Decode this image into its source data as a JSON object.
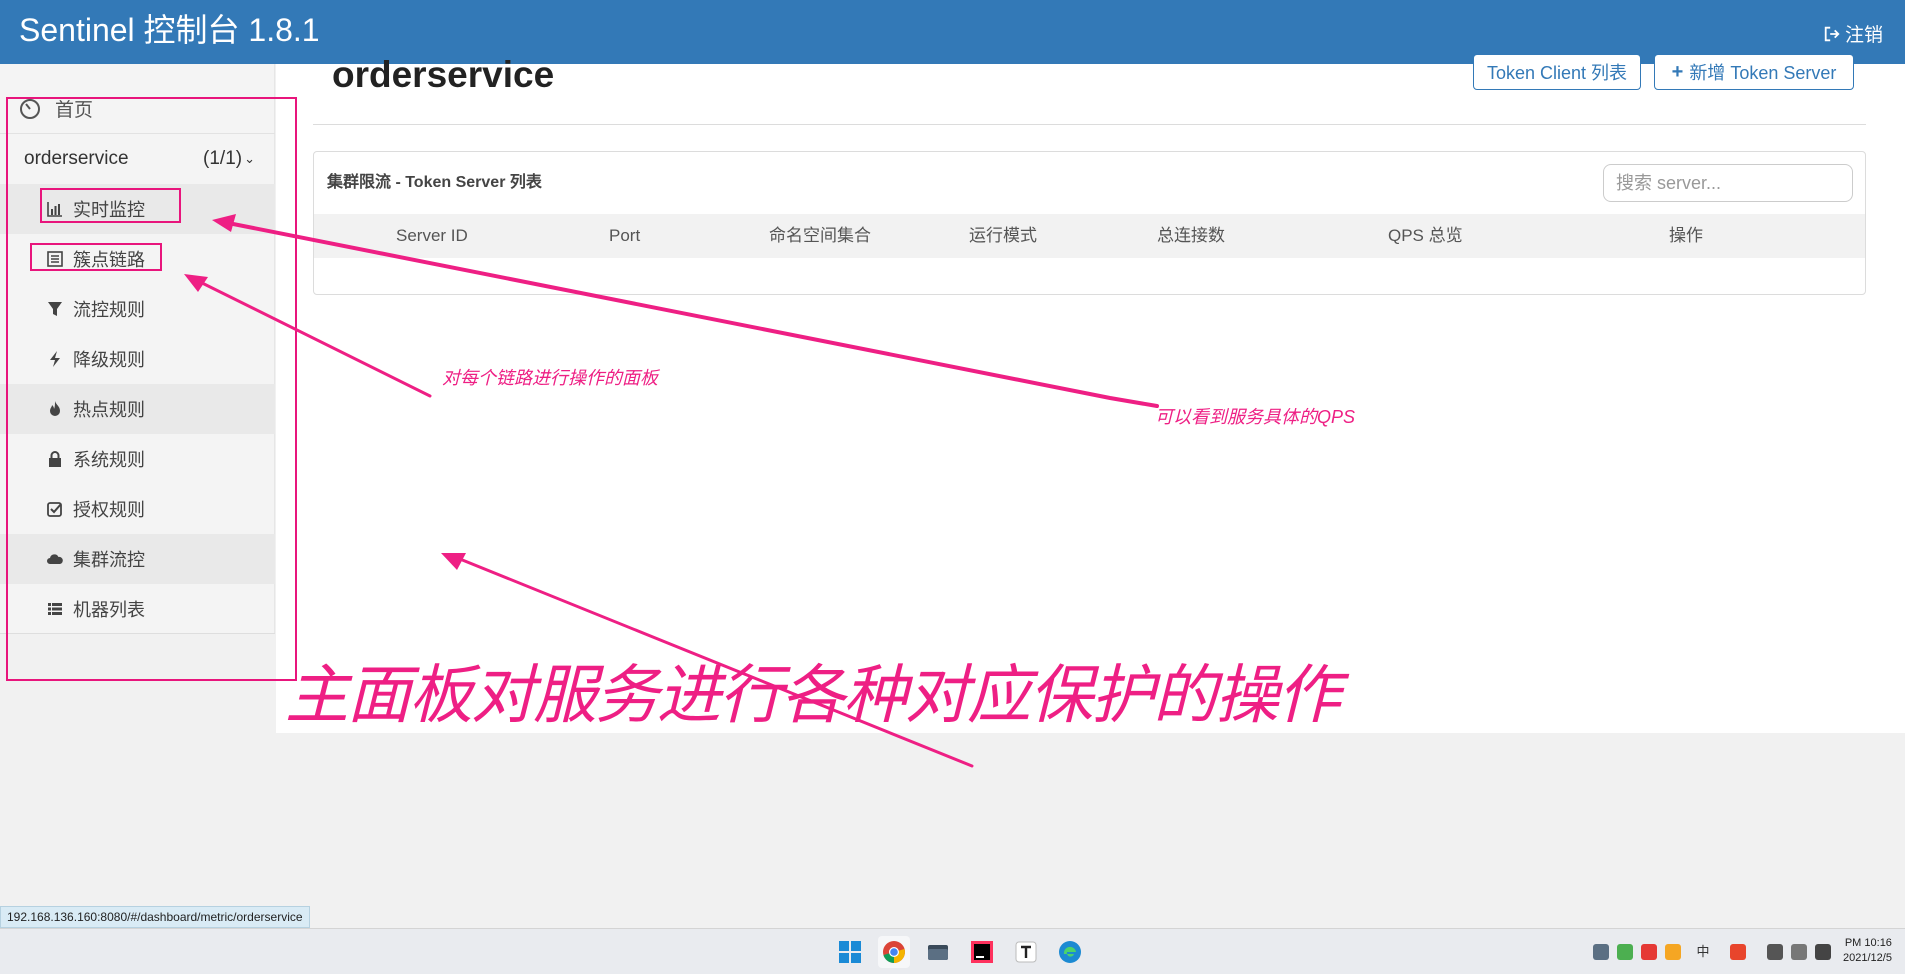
{
  "app": {
    "title": "Sentinel 控制台 1.8.1",
    "logout_label": "注销"
  },
  "sidebar": {
    "home_label": "首页",
    "app_name": "orderservice",
    "app_count": "(1/1)",
    "items": [
      {
        "label": "实时监控",
        "icon": "bar-chart-icon"
      },
      {
        "label": "簇点链路",
        "icon": "list-alt-icon"
      },
      {
        "label": "流控规则",
        "icon": "filter-icon"
      },
      {
        "label": "降级规则",
        "icon": "flash-icon"
      },
      {
        "label": "热点规则",
        "icon": "fire-icon"
      },
      {
        "label": "系统规则",
        "icon": "lock-icon"
      },
      {
        "label": "授权规则",
        "icon": "check-icon"
      },
      {
        "label": "集群流控",
        "icon": "cloud-icon"
      },
      {
        "label": "机器列表",
        "icon": "th-list-icon"
      }
    ]
  },
  "main": {
    "page_title": "orderservice",
    "token_client_button": "Token Client 列表",
    "add_server_button": "新增 Token Server",
    "panel_title": "集群限流 - Token Server 列表",
    "search_placeholder": "搜索 server...",
    "columns": [
      "Server ID",
      "Port",
      "命名空间集合",
      "运行模式",
      "总连接数",
      "QPS 总览",
      "操作"
    ]
  },
  "annotations": {
    "chain_panel": "对每个链路进行操作的面板",
    "qps_note": "可以看到服务具体的QPS",
    "main_panel": "主面板对服务进行各种对应保护的操作",
    "color": "#ee1f84"
  },
  "browser": {
    "status_url": "192.168.136.160:8080/#/dashboard/metric/orderservice"
  },
  "taskbar": {
    "apps": [
      "windows-start-icon",
      "chrome-icon",
      "file-explorer-icon",
      "intellij-icon",
      "typora-icon",
      "edge-icon"
    ],
    "tray": [
      "network-icon",
      "player-icon",
      "netease-icon",
      "office-icon",
      "ime-icon",
      "wps-icon",
      "display-icon",
      "volume-icon",
      "battery-icon"
    ],
    "time": "PM 10:16",
    "date": "2021/12/5"
  }
}
